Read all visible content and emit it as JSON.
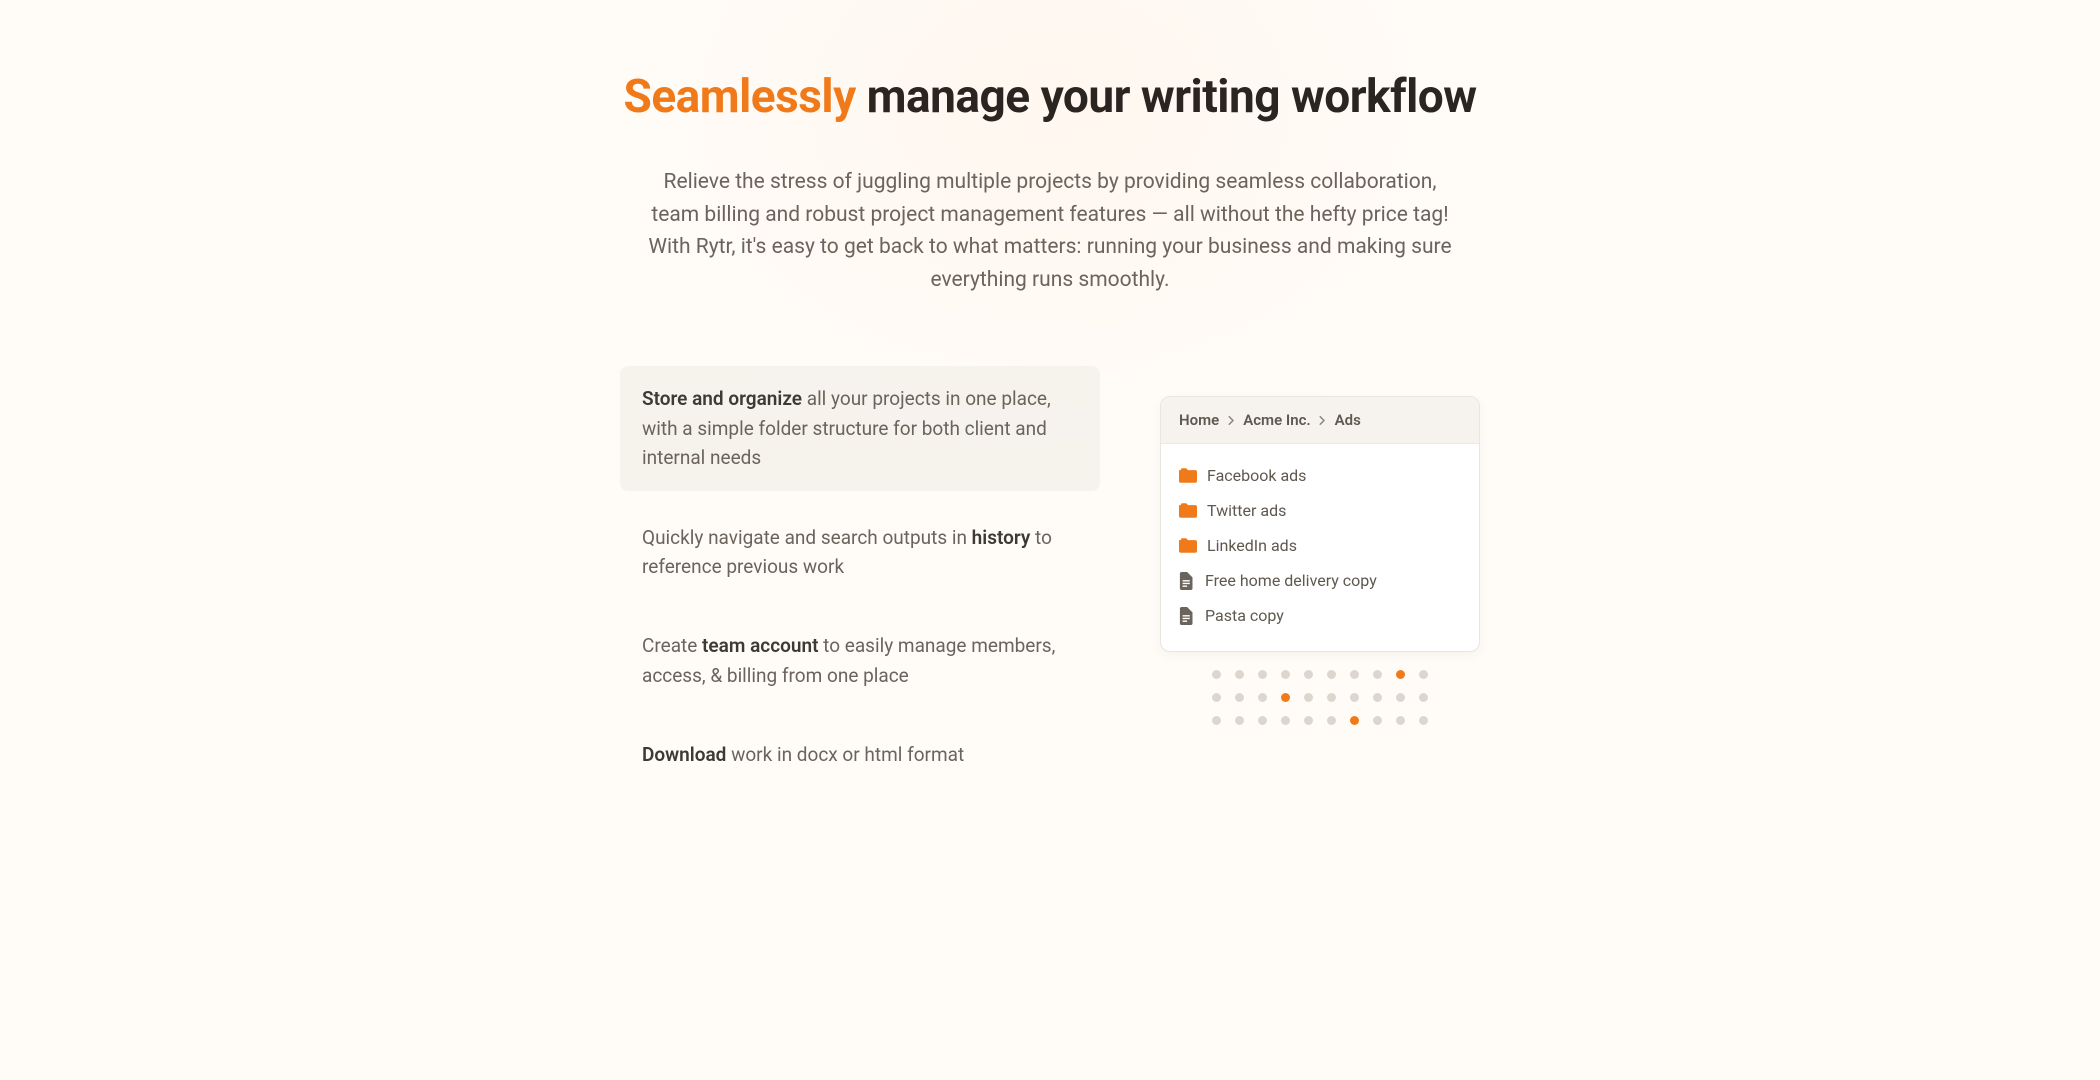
{
  "hero": {
    "title_accent": "Seamlessly",
    "title_rest": " manage your writing workflow",
    "subtitle": "Relieve the stress of juggling multiple projects by providing seamless collaboration, team billing and robust project management features — all without the hefty price tag! With Rytr, it's easy to get back to what matters: running your business and making sure everything runs smoothly."
  },
  "features": [
    {
      "bold": "Store and organize",
      "rest": " all your projects in one place, with a simple folder structure for both client and internal needs",
      "active": true
    },
    {
      "pre": "Quickly navigate and search outputs in ",
      "bold": "history",
      "rest": " to reference previous work",
      "active": false
    },
    {
      "pre": "Create ",
      "bold": "team account",
      "rest": " to easily manage members, access, & billing from one place",
      "active": false
    },
    {
      "bold": "Download",
      "rest": " work in docx or html format",
      "active": false
    }
  ],
  "preview": {
    "breadcrumb": [
      "Home",
      "Acme Inc.",
      "Ads"
    ],
    "items": [
      {
        "type": "folder",
        "label": "Facebook ads"
      },
      {
        "type": "folder",
        "label": "Twitter ads"
      },
      {
        "type": "folder",
        "label": "LinkedIn ads"
      },
      {
        "type": "doc",
        "label": "Free home delivery copy"
      },
      {
        "type": "doc",
        "label": "Pasta copy"
      }
    ]
  },
  "dots": {
    "rows": 3,
    "cols": 10,
    "on": [
      [
        0,
        8
      ],
      [
        1,
        3
      ],
      [
        2,
        6
      ]
    ]
  },
  "colors": {
    "accent": "#f07a1a"
  }
}
